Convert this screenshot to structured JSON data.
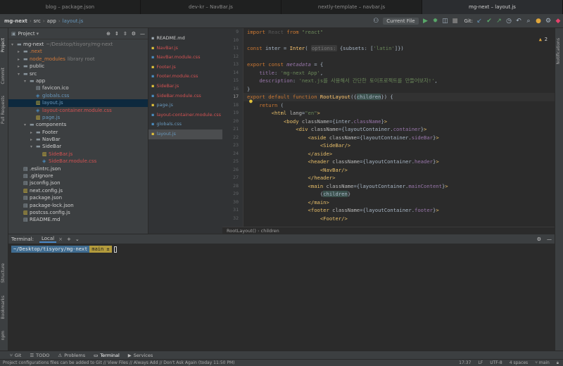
{
  "window_tabs": [
    "blog – package.json",
    "dev-kr – NavBar.js",
    "nextly-template – navbar.js",
    "mg-next – layout.js"
  ],
  "breadcrumb": [
    "mg-next",
    "src",
    "app",
    "layout.js"
  ],
  "toolbar": {
    "run_config": "Current File",
    "git_label": "Git:"
  },
  "side_labels": {
    "project": "Project",
    "commit": "Commit",
    "pull_requests": "Pull Requests",
    "structure": "Structure",
    "bookmarks": "Bookmarks",
    "npm": "npm",
    "notifications": "Notifications"
  },
  "project_panel": {
    "title": "Project",
    "tree": [
      {
        "label": "mg-next",
        "extra": "~/Desktop/tisyory/mg-next",
        "depth": 0,
        "arrow": "▾",
        "icon": "folder",
        "color": "#cfcfcf"
      },
      {
        "label": ".next",
        "extra": "",
        "depth": 1,
        "arrow": "▸",
        "icon": "folder",
        "color": "#d2793a"
      },
      {
        "label": "node_modules",
        "extra": "library root",
        "depth": 1,
        "arrow": "▸",
        "icon": "folder",
        "color": "#d2793a"
      },
      {
        "label": "public",
        "extra": "",
        "depth": 1,
        "arrow": "▸",
        "icon": "folder",
        "color": "#cfcfcf"
      },
      {
        "label": "src",
        "extra": "",
        "depth": 1,
        "arrow": "▾",
        "icon": "folder",
        "color": "#cfcfcf"
      },
      {
        "label": "app",
        "extra": "",
        "depth": 2,
        "arrow": "▾",
        "icon": "folder",
        "color": "#cfcfcf"
      },
      {
        "label": "favicon.ico",
        "extra": "",
        "depth": 3,
        "arrow": "",
        "icon": "file",
        "color": "#cfcfcf"
      },
      {
        "label": "globals.css",
        "extra": "",
        "depth": 3,
        "arrow": "",
        "icon": "css",
        "color": "#6897bb"
      },
      {
        "label": "layout.js",
        "extra": "",
        "depth": 3,
        "arrow": "",
        "icon": "js",
        "color": "#6897bb",
        "selected": true
      },
      {
        "label": "layout-container.module.css",
        "extra": "",
        "depth": 3,
        "arrow": "",
        "icon": "css",
        "color": "#d25252"
      },
      {
        "label": "page.js",
        "extra": "",
        "depth": 3,
        "arrow": "",
        "icon": "js",
        "color": "#6897bb"
      },
      {
        "label": "components",
        "extra": "",
        "depth": 2,
        "arrow": "▾",
        "icon": "folder",
        "color": "#cfcfcf"
      },
      {
        "label": "Footer",
        "extra": "",
        "depth": 3,
        "arrow": "▸",
        "icon": "folder",
        "color": "#cfcfcf"
      },
      {
        "label": "NavBar",
        "extra": "",
        "depth": 3,
        "arrow": "▸",
        "icon": "folder",
        "color": "#cfcfcf"
      },
      {
        "label": "SideBar",
        "extra": "",
        "depth": 3,
        "arrow": "▾",
        "icon": "folder",
        "color": "#cfcfcf"
      },
      {
        "label": "SideBar.js",
        "extra": "",
        "depth": 4,
        "arrow": "",
        "icon": "js",
        "color": "#d25252"
      },
      {
        "label": "SideBar.module.css",
        "extra": "",
        "depth": 4,
        "arrow": "",
        "icon": "css",
        "color": "#d25252"
      },
      {
        "label": ".eslintrc.json",
        "extra": "",
        "depth": 1,
        "arrow": "",
        "icon": "file",
        "color": "#cfcfcf"
      },
      {
        "label": ".gitignore",
        "extra": "",
        "depth": 1,
        "arrow": "",
        "icon": "file",
        "color": "#cfcfcf"
      },
      {
        "label": "jsconfig.json",
        "extra": "",
        "depth": 1,
        "arrow": "",
        "icon": "file",
        "color": "#cfcfcf"
      },
      {
        "label": "next.config.js",
        "extra": "",
        "depth": 1,
        "arrow": "",
        "icon": "js",
        "color": "#cfcfcf"
      },
      {
        "label": "package.json",
        "extra": "",
        "depth": 1,
        "arrow": "",
        "icon": "file",
        "color": "#cfcfcf"
      },
      {
        "label": "package-lock.json",
        "extra": "",
        "depth": 1,
        "arrow": "",
        "icon": "file",
        "color": "#cfcfcf"
      },
      {
        "label": "postcss.config.js",
        "extra": "",
        "depth": 1,
        "arrow": "",
        "icon": "js",
        "color": "#cfcfcf"
      },
      {
        "label": "README.md",
        "extra": "",
        "depth": 1,
        "arrow": "",
        "icon": "file",
        "color": "#cfcfcf"
      }
    ]
  },
  "file_list": [
    {
      "label": "README.md",
      "color": "#cfcfcf"
    },
    {
      "label": "NavBar.js",
      "color": "#d25252"
    },
    {
      "label": "NavBar.module.css",
      "color": "#d25252"
    },
    {
      "label": "Footer.js",
      "color": "#d25252"
    },
    {
      "label": "Footer.module.css",
      "color": "#d25252"
    },
    {
      "label": "SideBar.js",
      "color": "#d25252"
    },
    {
      "label": "SideBar.module.css",
      "color": "#d25252"
    },
    {
      "label": "page.js",
      "color": "#6897bb"
    },
    {
      "label": "layout-container.module.css",
      "color": "#d25252"
    },
    {
      "label": "globals.css",
      "color": "#6897bb"
    },
    {
      "label": "layout.js",
      "color": "#6897bb",
      "selected": true
    }
  ],
  "editor": {
    "line_numbers": [
      "9",
      "10",
      "11",
      "12",
      "13",
      "14",
      "15",
      "16",
      "17",
      "18",
      "19",
      "20",
      "21",
      "22",
      "23",
      "24",
      "25",
      "26",
      "27",
      "28",
      "29",
      "30",
      "31",
      "32"
    ],
    "current_line": "17",
    "warning_count": "2",
    "breadcrumb": [
      "RootLayout()",
      "children"
    ]
  },
  "terminal": {
    "title": "Terminal:",
    "tab": "Local",
    "path": "~/Desktop/tisyory/mg-next",
    "branch": "main ±"
  },
  "bottom_tabs": [
    "Git",
    "TODO",
    "Problems",
    "Terminal",
    "Services"
  ],
  "active_bottom_tab": "Terminal",
  "status": {
    "message": "Project configurations files can be added to Git // View Files // Always Add // Don't Ask Again (today 11:50 PM)",
    "position": "17:37",
    "line_sep": "LF",
    "encoding": "UTF-8",
    "indent": "4 spaces",
    "branch": "main"
  }
}
